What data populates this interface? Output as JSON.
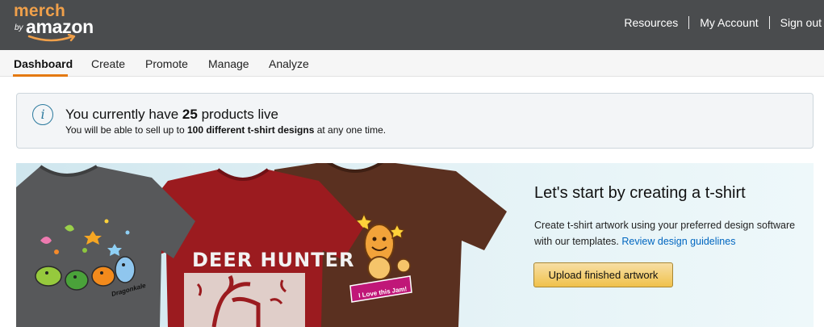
{
  "header": {
    "logo_merch": "merch",
    "logo_by": "by",
    "logo_amazon": "amazon",
    "nav": [
      "Resources",
      "My Account",
      "Sign out"
    ]
  },
  "tabs": [
    "Dashboard",
    "Create",
    "Promote",
    "Manage",
    "Analyze"
  ],
  "active_tab": "Dashboard",
  "info": {
    "icon": "info-icon",
    "line1_prefix": "You currently have ",
    "line1_count": "25",
    "line1_suffix": " products live",
    "line2_prefix": "You will be able to sell up to ",
    "line2_bold": "100 different t-shirt designs",
    "line2_suffix": " at any one time."
  },
  "banner": {
    "title": "Let's start by creating a t-shirt",
    "text": "Create t-shirt artwork using your preferred design software with our templates.",
    "link": "Review design guidelines",
    "button": "Upload finished artwork",
    "shirt2_text": "DEER HUNTER",
    "shirt1_text": "Dragonkale",
    "shirt3_text": "I Love this Jam!"
  },
  "colors": {
    "header_bg": "#4a4c4e",
    "brand_orange": "#e47911",
    "link_blue": "#0066c0",
    "button_yellow": "#f0c14b"
  }
}
